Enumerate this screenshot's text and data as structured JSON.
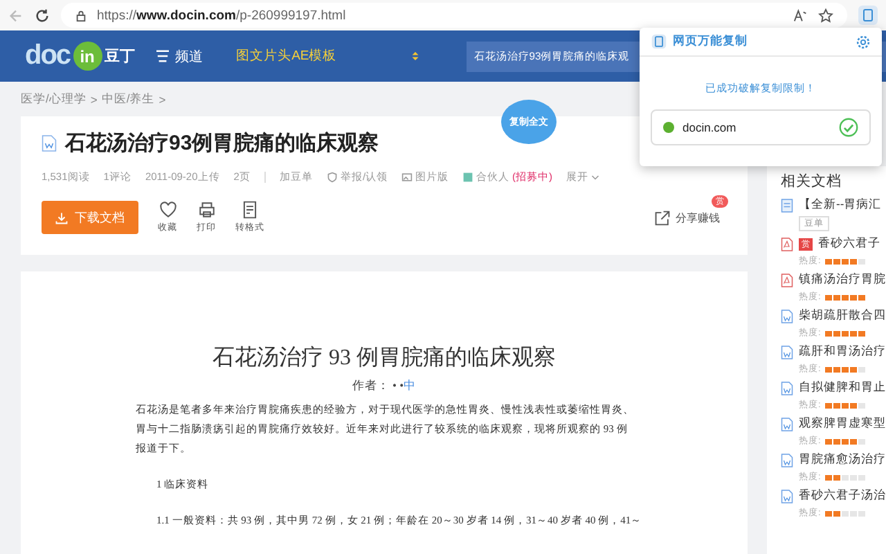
{
  "browser": {
    "url_prefix": "https://",
    "url_host": "www.docin.com",
    "url_path": "/p-260999197.html"
  },
  "header": {
    "logo_text": "doc",
    "logo_badge": "in",
    "logo_cn": "豆丁",
    "menu_label": "频道",
    "promo": "图文片头AE模板",
    "search_value": "石花汤治疗93例胃脘痛的临床观"
  },
  "breadcrumb": [
    {
      "label": "医学/心理学"
    },
    {
      "label": "中医/养生"
    }
  ],
  "breadcrumb_sep": ">",
  "document": {
    "title": "石花汤治疗93例胃脘痛的临床观察",
    "copy_button": "复制全文",
    "meta": [
      {
        "kind": "text",
        "label": "1,531阅读"
      },
      {
        "kind": "text",
        "label": "1评论"
      },
      {
        "kind": "text",
        "label": "2011-09-20上传"
      },
      {
        "kind": "text",
        "label": "2页"
      },
      {
        "kind": "divider"
      },
      {
        "kind": "link",
        "label": "加豆单"
      },
      {
        "kind": "shield",
        "label": "举报/认领"
      },
      {
        "kind": "image",
        "label": "图片版"
      },
      {
        "kind": "partner",
        "label": "合伙人",
        "highlight": "(招募中)"
      },
      {
        "kind": "more",
        "label": "展开"
      }
    ],
    "download": "下载文档",
    "actions": [
      {
        "kind": "heart",
        "label": "收藏"
      },
      {
        "kind": "printer",
        "label": "打印"
      },
      {
        "kind": "convert",
        "label": "转格式"
      }
    ],
    "share": {
      "label": "分享赚钱",
      "badge": "赏"
    }
  },
  "page": {
    "title": "石花汤治疗 93 例胃脘痛的临床观察",
    "author_label": "作者：",
    "author_dots": "• •",
    "author_name": "中",
    "paragraphs": [
      {
        "kind": "body",
        "text": "石花汤是笔者多年来治疗胃脘痛疾患的经验方，对于现代医学的急性胃炎、慢性浅表性或萎缩性胃炎、胃与十二指肠溃疡引起的胃脘痛疗效较好。近年来对此进行了较系统的临床观察，现将所观察的 93 例报道于下。"
      },
      {
        "kind": "heading",
        "text": "1 临床资料"
      },
      {
        "kind": "heading",
        "text": "1.1 一般资料：共 93 例，其中男 72 例，女 21 例；年龄在 20～30 岁者 14 例，31～40 岁者 40 例，41～"
      }
    ]
  },
  "popup": {
    "title": "网页万能复制",
    "message": "已成功破解复制限制！",
    "site": "docin.com",
    "enabled": true
  },
  "related": {
    "title": "相关文档",
    "items": [
      {
        "kind": "doc",
        "title": "【全新--胃病汇",
        "tag": "豆单"
      },
      {
        "kind": "pdf",
        "title": "香砂六君子",
        "badge": "赏",
        "heat_label": "热度:",
        "stars": 4
      },
      {
        "kind": "pdf",
        "title": "镇痛汤治疗胃脘",
        "heat_label": "热度:",
        "stars": 5
      },
      {
        "kind": "word",
        "title": "柴胡疏肝散合四",
        "heat_label": "热度:",
        "stars": 5
      },
      {
        "kind": "word",
        "title": "疏肝和胃汤治疗",
        "heat_label": "热度:",
        "stars": 4
      },
      {
        "kind": "word",
        "title": "自拟健脾和胃止",
        "heat_label": "热度:",
        "stars": 4
      },
      {
        "kind": "word",
        "title": "观察脾胃虚寒型",
        "heat_label": "热度:",
        "stars": 4
      },
      {
        "kind": "word",
        "title": "胃脘痛愈汤治疗",
        "heat_label": "热度:",
        "stars": 2
      },
      {
        "kind": "word",
        "title": "香砂六君子汤治",
        "heat_label": "热度:",
        "stars": 2
      }
    ]
  }
}
